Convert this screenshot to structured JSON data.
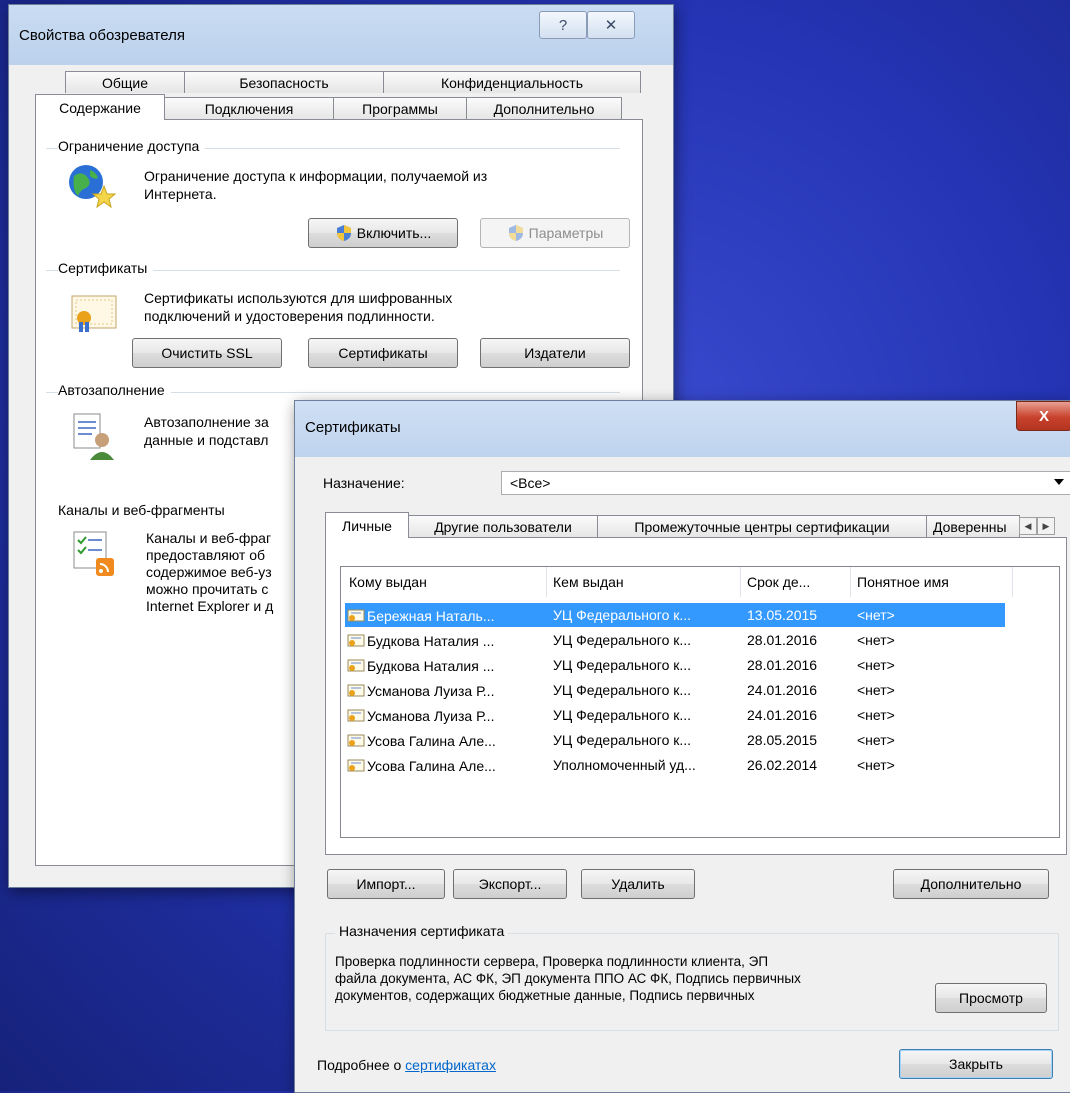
{
  "props": {
    "title": "Свойства обозревателя",
    "help_label": "?",
    "close_label": "✕",
    "tabs_row1": [
      "Общие",
      "Безопасность",
      "Конфиденциальность"
    ],
    "tabs_row2": [
      "Содержание",
      "Подключения",
      "Программы",
      "Дополнительно"
    ],
    "access": {
      "label": "Ограничение доступа",
      "desc_line1": "Ограничение доступа к информации, получаемой из",
      "desc_line2": "Интернета.",
      "enable_label": "Включить...",
      "params_label": "Параметры"
    },
    "certs": {
      "label": "Сертификаты",
      "desc_line1": "Сертификаты используются для шифрованных",
      "desc_line2": "подключений и удостоверения подлинности.",
      "clear_ssl_label": "Очистить SSL",
      "certificates_label": "Сертификаты",
      "publishers_label": "Издатели"
    },
    "autofill": {
      "label": "Автозаполнение",
      "desc_line1": "Автозаполнение за",
      "desc_line2": "данные и подставл"
    },
    "feeds": {
      "label": "Каналы и веб-фрагменты",
      "lines": [
        "Каналы и веб-фраг",
        "предоставляют об",
        "содержимое веб-уз",
        "можно прочитать с",
        "Internet Explorer и д"
      ]
    }
  },
  "certdlg": {
    "title": "Сертификаты",
    "close_label": "X",
    "purpose_label": "Назначение:",
    "purpose_value": "<Все>",
    "tabs": [
      "Личные",
      "Другие пользователи",
      "Промежуточные центры сертификации",
      "Доверенны"
    ],
    "columns": [
      "Кому выдан",
      "Кем выдан",
      "Срок де...",
      "Понятное имя"
    ],
    "rows": [
      {
        "to": "Бережная Наталь...",
        "by": "УЦ Федерального к...",
        "exp": "13.05.2015",
        "name": "<нет>"
      },
      {
        "to": "Будкова Наталия ...",
        "by": "УЦ Федерального к...",
        "exp": "28.01.2016",
        "name": "<нет>"
      },
      {
        "to": "Будкова Наталия ...",
        "by": "УЦ Федерального к...",
        "exp": "28.01.2016",
        "name": "<нет>"
      },
      {
        "to": "Усманова Луиза Р...",
        "by": "УЦ Федерального к...",
        "exp": "24.01.2016",
        "name": "<нет>"
      },
      {
        "to": "Усманова Луиза Р...",
        "by": "УЦ Федерального к...",
        "exp": "24.01.2016",
        "name": "<нет>"
      },
      {
        "to": "Усова Галина Але...",
        "by": "УЦ Федерального к...",
        "exp": "28.05.2015",
        "name": "<нет>"
      },
      {
        "to": "Усова Галина Але...",
        "by": "Уполномоченный уд...",
        "exp": "26.02.2014",
        "name": "<нет>"
      }
    ],
    "import_label": "Импорт...",
    "export_label": "Экспорт...",
    "delete_label": "Удалить",
    "advanced_label": "Дополнительно",
    "purposes_label": "Назначения сертификата",
    "purposes_line1": "Проверка подлинности сервера, Проверка подлинности клиента, ЭП",
    "purposes_line2": "файла документа, АС ФК, ЭП документа ППО АС ФК, Подпись первичных",
    "purposes_line3": "документов, содержащих бюджетные данные, Подпись первичных",
    "view_label": "Просмотр",
    "more_prefix": "Подробнее о ",
    "more_link": "сертификатах",
    "close_button_label": "Закрыть"
  },
  "colors": {
    "selection": "#3399ff",
    "link": "#0066cc",
    "desktop": "#2434b4"
  }
}
